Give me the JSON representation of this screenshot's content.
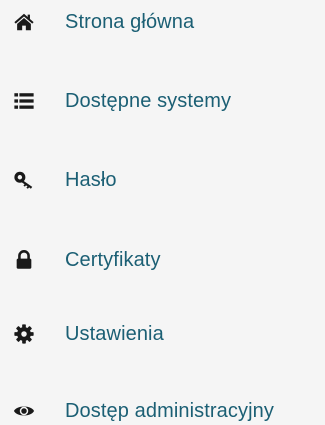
{
  "nav": {
    "items": [
      {
        "label": "Strona główna",
        "icon": "home-icon"
      },
      {
        "label": "Dostępne systemy",
        "icon": "list-icon"
      },
      {
        "label": "Hasło",
        "icon": "key-icon"
      },
      {
        "label": "Certyfikaty",
        "icon": "lock-icon"
      },
      {
        "label": "Ustawienia",
        "icon": "gear-icon"
      },
      {
        "label": "Dostęp administracyjny",
        "icon": "eye-icon"
      }
    ]
  },
  "colors": {
    "background": "#f5f5f5",
    "label_text": "#1b5f74",
    "icon": "#1a1a1a"
  }
}
